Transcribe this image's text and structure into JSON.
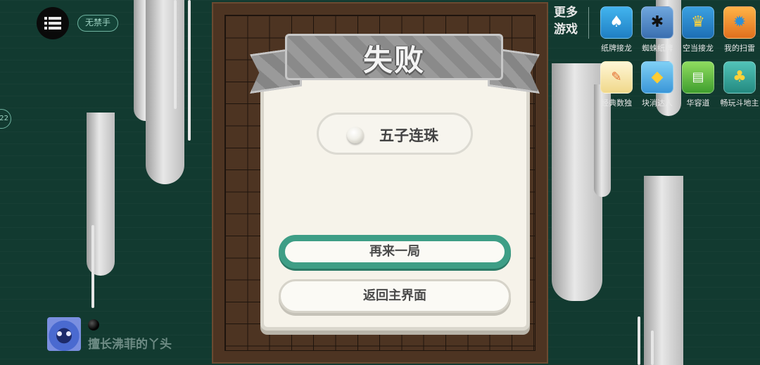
{
  "top_left": {
    "menu_icon": "menu-icon",
    "rule_badge": "无禁手",
    "side_badge": "22"
  },
  "player": {
    "name": "擅长沸菲的丫头",
    "stone": "black"
  },
  "more_games": {
    "label": "更多游戏",
    "games": [
      {
        "label": "纸牌接龙",
        "icon": "cards-icon",
        "color": "#2f9ad6"
      },
      {
        "label": "蜘蛛纸牌",
        "icon": "spider-icon",
        "color": "#4f86c6"
      },
      {
        "label": "空当接龙",
        "icon": "crown-cards-icon",
        "color": "#2f8fd0"
      },
      {
        "label": "我的扫雷",
        "icon": "mine-icon",
        "color": "#f08a2a"
      },
      {
        "label": "经典数独",
        "icon": "sudoku-icon",
        "color": "#f7e5a8"
      },
      {
        "label": "块消达人",
        "icon": "blocks-icon",
        "color": "#55b6e6"
      },
      {
        "label": "华容道",
        "icon": "train-icon",
        "color": "#6fc24a"
      },
      {
        "label": "畅玩斗地主",
        "icon": "landlord-icon",
        "color": "#3aa9a0"
      }
    ]
  },
  "dialog": {
    "title": "失败",
    "mode": "五子连珠",
    "mode_stone": "white",
    "replay_label": "再来一局",
    "home_label": "返回主界面"
  },
  "colors": {
    "background": "#123a30",
    "accent": "#3e9e86",
    "board": "#4d3422"
  }
}
